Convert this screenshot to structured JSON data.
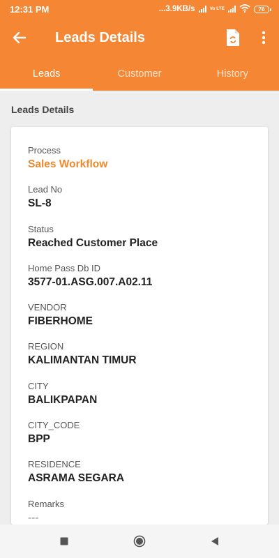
{
  "status_bar": {
    "time": "12:31 PM",
    "network_speed": "...3.9KB/s",
    "volte": "Vo LTE",
    "battery": "76"
  },
  "app_bar": {
    "title": "Leads Details",
    "back_icon": "arrow-left-icon",
    "document_icon": "document-sync-icon",
    "menu_icon": "more-vertical-icon"
  },
  "tabs": [
    {
      "label": "Leads",
      "active": true
    },
    {
      "label": "Customer",
      "active": false
    },
    {
      "label": "History",
      "active": false
    }
  ],
  "section_title": "Leads Details",
  "fields": [
    {
      "label": "Process",
      "value": "Sales Workflow"
    },
    {
      "label": "Lead No",
      "value": "SL-8"
    },
    {
      "label": "Status",
      "value": "Reached Customer Place"
    },
    {
      "label": "Home Pass Db ID",
      "value": "3577-01.ASG.007.A02.11"
    },
    {
      "label": "VENDOR",
      "value": "FIBERHOME"
    },
    {
      "label": "REGION",
      "value": "KALIMANTAN TIMUR"
    },
    {
      "label": "CITY",
      "value": "BALIKPAPAN"
    },
    {
      "label": "CITY_CODE",
      "value": "BPP"
    },
    {
      "label": "RESIDENCE",
      "value": "ASRAMA SEGARA"
    },
    {
      "label": "Remarks",
      "value": "---"
    }
  ],
  "colors": {
    "primary": "#f58634",
    "accent_text": "#ee8a2e"
  }
}
